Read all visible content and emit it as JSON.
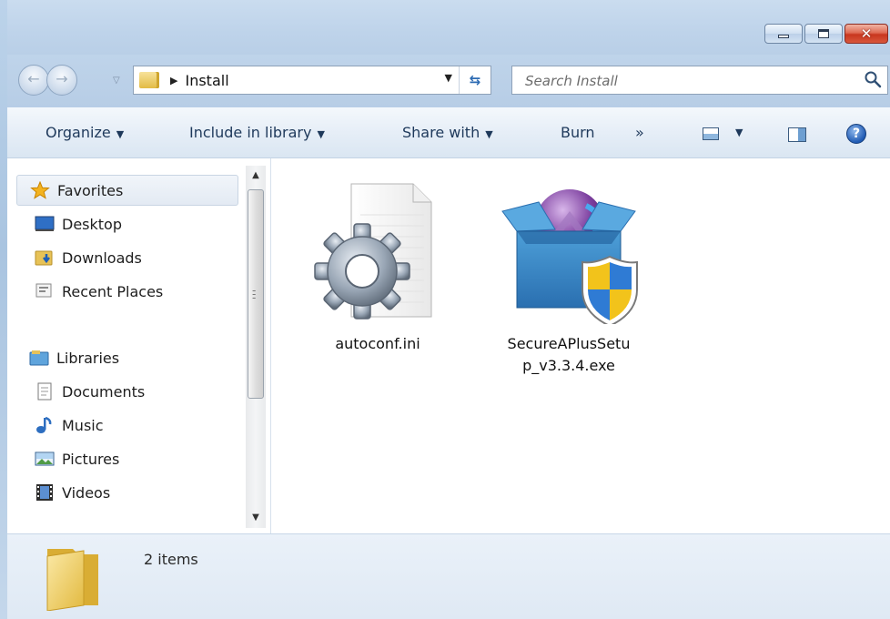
{
  "address": {
    "crumb": "Install"
  },
  "search": {
    "placeholder": "Search Install"
  },
  "toolbar": {
    "organize": "Organize",
    "include_in_library": "Include in library",
    "share_with": "Share with",
    "burn": "Burn",
    "more": "»"
  },
  "navigation": {
    "favorites": {
      "label": "Favorites",
      "items": [
        "Desktop",
        "Downloads",
        "Recent Places"
      ]
    },
    "libraries": {
      "label": "Libraries",
      "items": [
        "Documents",
        "Music",
        "Pictures",
        "Videos"
      ]
    }
  },
  "files": [
    {
      "name_line1": "autoconf.ini",
      "name_line2": "",
      "icon": "ini-settings-file-icon"
    },
    {
      "name_line1": "SecureAPlusSetu",
      "name_line2": "p_v3.3.4.exe",
      "icon": "installer-box-uac-shield-icon"
    }
  ],
  "status": {
    "item_count": "2 items"
  },
  "colors": {
    "accent": "#1e395b",
    "frame": "#bed3ea",
    "close": "#c8361e"
  }
}
